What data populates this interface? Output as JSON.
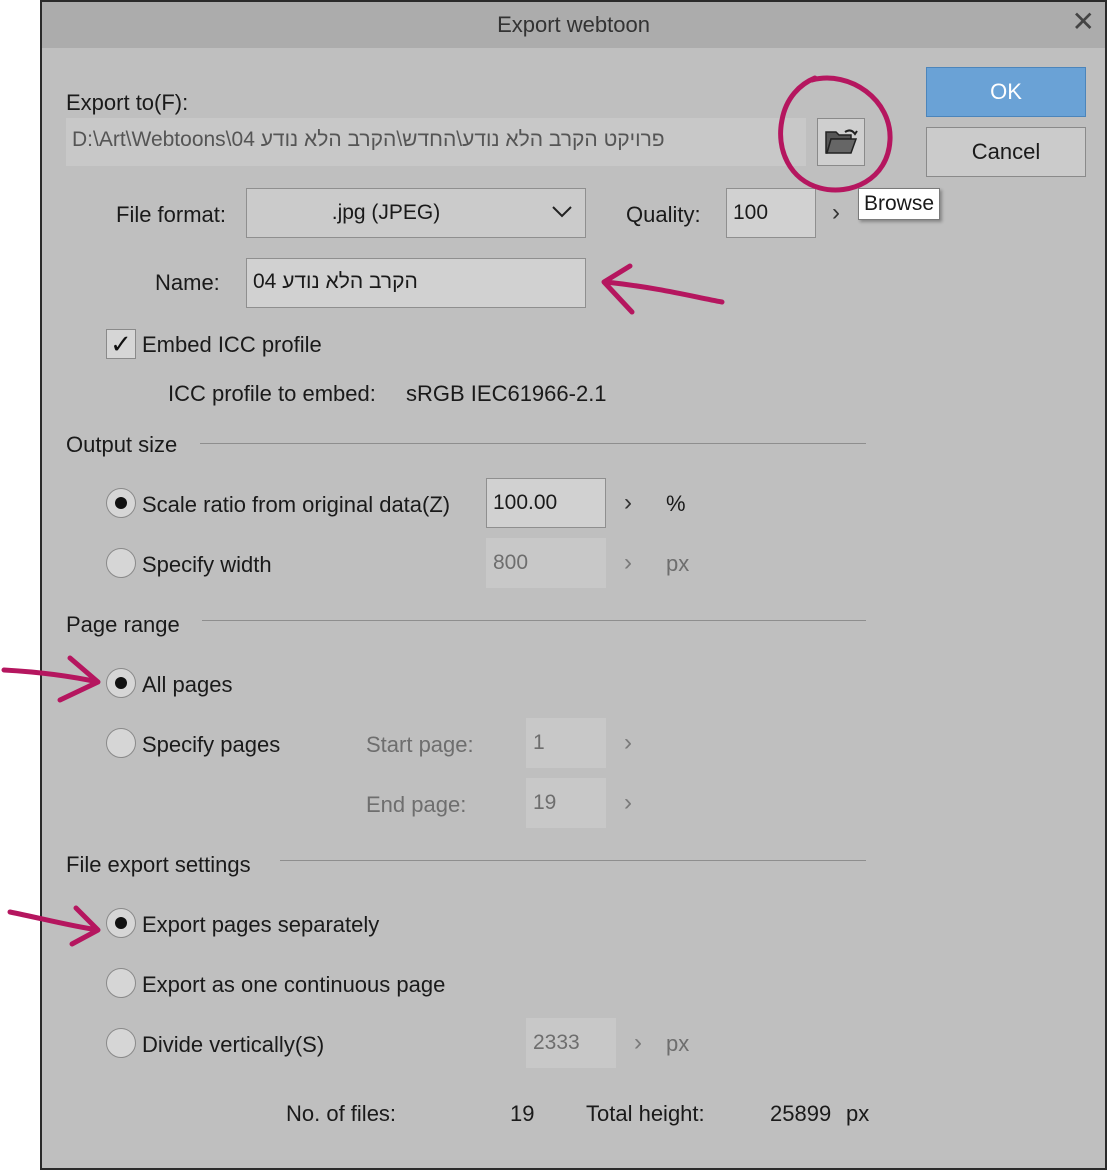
{
  "dialog": {
    "title": "Export webtoon",
    "close_icon": "close-icon"
  },
  "export_to": {
    "label": "Export to(F):",
    "path": "D:\\Art\\Webtoons\\04 פרויקט הקרב הלא נודע\\החדש\\הקרב הלא נודע",
    "browse_icon": "folder-open-icon",
    "browse_tooltip": "Browse"
  },
  "buttons": {
    "ok": "OK",
    "cancel": "Cancel"
  },
  "file_format": {
    "label": "File format:",
    "value": ".jpg (JPEG)",
    "quality_label": "Quality:",
    "quality_value": "100"
  },
  "name": {
    "label": "Name:",
    "value": "הקרב הלא נודע 04"
  },
  "icc": {
    "embed_label": "Embed ICC profile",
    "embed_checked": true,
    "profile_label": "ICC profile to embed:",
    "profile_value": "sRGB IEC61966-2.1"
  },
  "output_size": {
    "heading": "Output size",
    "scale_label": "Scale ratio from original data(Z)",
    "scale_selected": true,
    "scale_value": "100.00",
    "scale_unit": "%",
    "width_label": "Specify width",
    "width_selected": false,
    "width_value": "800",
    "width_unit": "px"
  },
  "page_range": {
    "heading": "Page range",
    "all_label": "All pages",
    "all_selected": true,
    "specify_label": "Specify pages",
    "specify_selected": false,
    "start_label": "Start page:",
    "start_value": "1",
    "end_label": "End page:",
    "end_value": "19"
  },
  "file_export": {
    "heading": "File export settings",
    "separately_label": "Export pages separately",
    "separately_selected": true,
    "continuous_label": "Export as one continuous page",
    "continuous_selected": false,
    "divide_label": "Divide vertically(S)",
    "divide_selected": false,
    "divide_value": "2333",
    "divide_unit": "px"
  },
  "summary": {
    "files_label": "No. of files:",
    "files_value": "19",
    "height_label": "Total height:",
    "height_value": "25899",
    "height_unit": "px"
  },
  "colors": {
    "dialog_bg": "#bfbfbf",
    "titlebar_bg": "#acacac",
    "primary_button": "#6aa2d6",
    "annotation_magenta": "#b5165f"
  }
}
